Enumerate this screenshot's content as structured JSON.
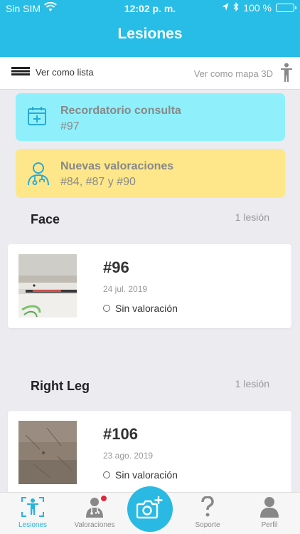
{
  "status_bar": {
    "carrier": "Sin SIM",
    "time": "12:02 p. m.",
    "battery": "100 %"
  },
  "header": {
    "title": "Lesiones"
  },
  "view_toggle": {
    "list_label": "Ver como lista",
    "map_label": "Ver como mapa 3D"
  },
  "banners": [
    {
      "title": "Recordatorio consulta",
      "subtitle": "#97",
      "color": "#8ff0fc",
      "icon": "calendar-plus-icon"
    },
    {
      "title": "Nuevas valoraciones",
      "subtitle": "#84, #87 y #90",
      "color": "#fde78a",
      "icon": "doctor-icon"
    }
  ],
  "sections": [
    {
      "name": "Face",
      "count": "1 lesión",
      "lesion": {
        "id": "#96",
        "date": "24 jul. 2019",
        "status": "Sin valoración"
      }
    },
    {
      "name": "Right Leg",
      "count": "1 lesión",
      "lesion": {
        "id": "#106",
        "date": "23 ago. 2019",
        "status": "Sin valoración"
      }
    }
  ],
  "tabbar": {
    "tabs": [
      {
        "label": "Lesiones",
        "icon": "body-scan-icon",
        "active": true
      },
      {
        "label": "Valoraciones",
        "icon": "doctor-icon",
        "active": false,
        "badge": true
      },
      {
        "label": "",
        "icon": "camera-add-icon",
        "active": false
      },
      {
        "label": "Soporte",
        "icon": "question-icon",
        "active": false
      },
      {
        "label": "Perfil",
        "icon": "user-icon",
        "active": false
      }
    ]
  },
  "colors": {
    "accent": "#27bde6",
    "active_tab": "#27b3df",
    "badge": "#e0283c"
  }
}
